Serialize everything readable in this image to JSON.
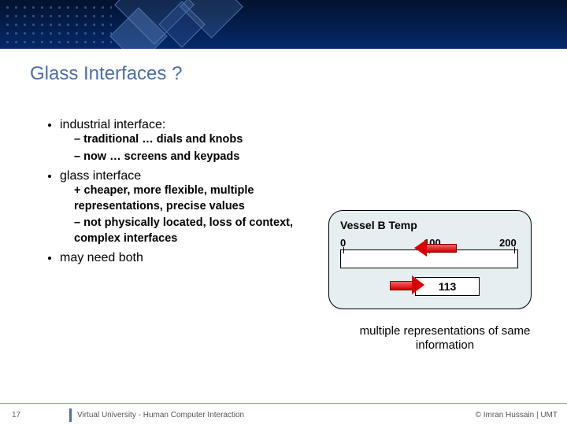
{
  "title": "Glass Interfaces ?",
  "bullets": {
    "b1": "industrial interface:",
    "b1s1": "traditional … dials and knobs",
    "b1s2": "now … screens and keypads",
    "b2": "glass interface",
    "b2s1": "cheaper, more flexible, multiple representations, precise values",
    "b2s2": "not physically located, loss of context, complex interfaces",
    "b3": "may need both"
  },
  "diagram": {
    "title": "Vessel B Temp",
    "scale": {
      "min": "0",
      "mid": "100",
      "max": "200"
    },
    "value": "113",
    "caption": "multiple representations of same information"
  },
  "chart_data": {
    "type": "bar",
    "title": "Vessel B Temp",
    "xlim": [
      0,
      200
    ],
    "ticks": [
      0,
      100,
      200
    ],
    "value": 113
  },
  "footer": {
    "page": "17",
    "course": "Virtual University - Human Computer Interaction",
    "copyright": "© Imran Hussain | UMT"
  }
}
